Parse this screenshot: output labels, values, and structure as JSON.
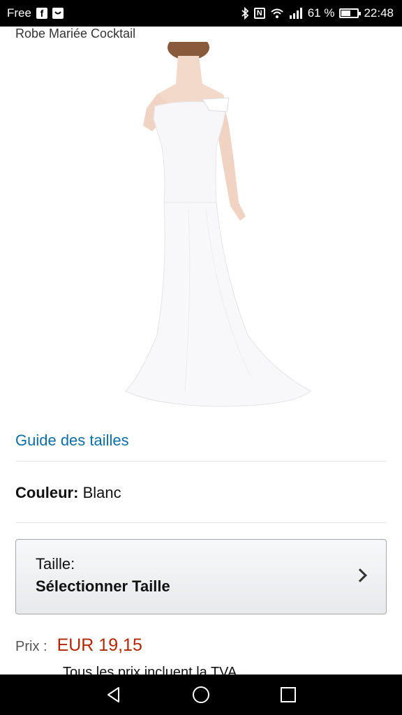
{
  "status_bar": {
    "carrier": "Free",
    "battery_percent": "61 %",
    "battery_level": 0.61,
    "time": "22:48",
    "icons": [
      "facebook-icon",
      "notification-icon",
      "bluetooth-icon",
      "nfc-icon",
      "wifi-icon",
      "signal-icon",
      "battery-icon"
    ]
  },
  "product": {
    "title": "Robe Mariée Cocktail",
    "size_guide_link": "Guide des tailles",
    "color_label": "Couleur:",
    "color_value": "Blanc",
    "size_label": "Taille:",
    "size_value": "Sélectionner Taille",
    "price_label": "Prix :",
    "price_value": "EUR 19,15",
    "tax_note": "Tous les prix incluent la TVA."
  },
  "colors": {
    "link": "#0f6ea3",
    "price": "#b12704"
  },
  "nav_bar": {
    "buttons": [
      "back-icon",
      "home-icon",
      "recents-icon"
    ]
  }
}
